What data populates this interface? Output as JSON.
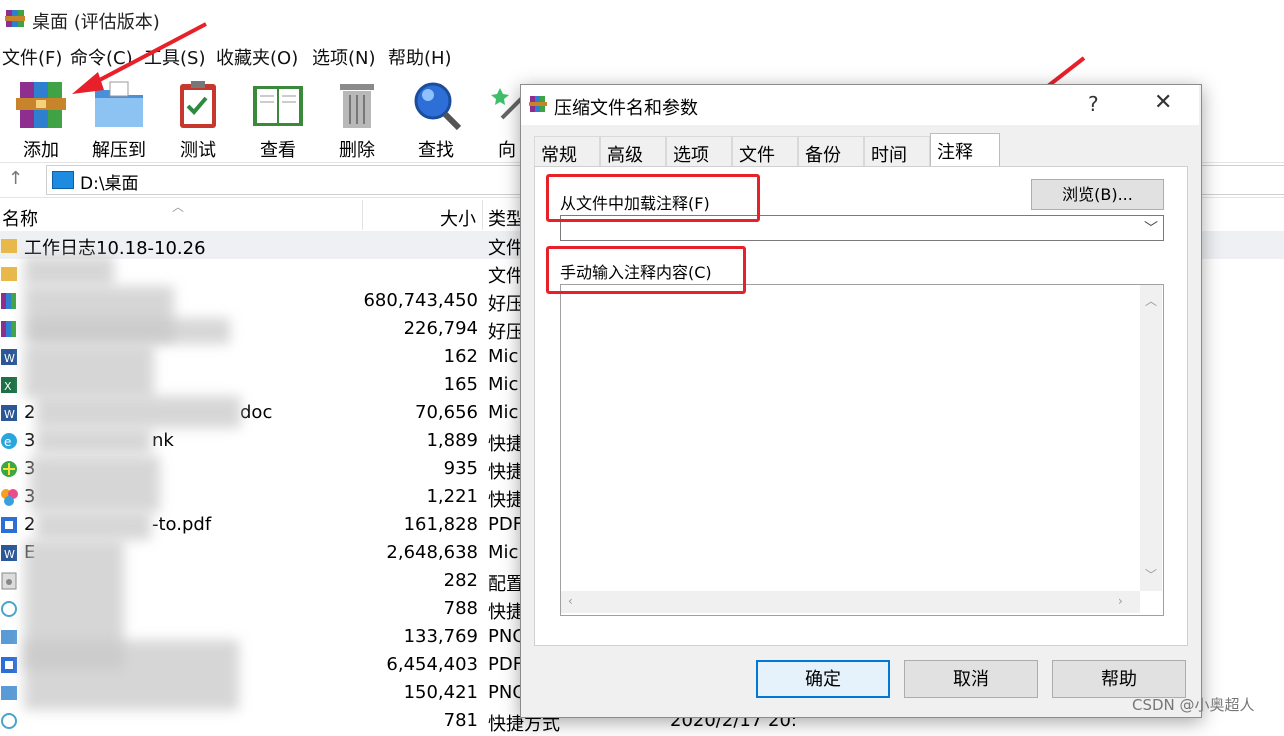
{
  "window": {
    "title": "桌面 (评估版本)"
  },
  "menu": [
    "文件(F)",
    "命令(C)",
    "工具(S)",
    "收藏夹(O)",
    "选项(N)",
    "帮助(H)"
  ],
  "toolbar": [
    "添加",
    "解压到",
    "测试",
    "查看",
    "删除",
    "查找",
    "向导"
  ],
  "address": {
    "path": "D:\\桌面"
  },
  "columns": {
    "name": "名称",
    "size": "大小",
    "type": "类型"
  },
  "files": [
    {
      "name": "工作日志10.18-10.26",
      "size": "",
      "type": "文件",
      "date": "",
      "icon": "folder-icon"
    },
    {
      "name": "",
      "size": "",
      "type": "文件",
      "date": "",
      "icon": "folder-icon"
    },
    {
      "name": "",
      "size": "680,743,450",
      "type": "好压",
      "date": "",
      "icon": "archive-icon"
    },
    {
      "name": "",
      "size": "226,794",
      "type": "好压",
      "date": "",
      "icon": "archive-icon"
    },
    {
      "name": "",
      "size": "162",
      "type": "Mic",
      "date": "",
      "icon": "word-icon"
    },
    {
      "name": "",
      "size": "165",
      "type": "Mic",
      "date": "",
      "icon": "excel-icon"
    },
    {
      "name": "2",
      "size": "70,656",
      "type": "Mic",
      "date": "",
      "icon": "word-icon"
    },
    {
      "name": "3",
      "size": "1,889",
      "type": "快捷",
      "date": "",
      "icon": "ie-shortcut-icon"
    },
    {
      "name": "3",
      "size": "935",
      "type": "快捷",
      "date": "",
      "icon": "green-shortcut-icon"
    },
    {
      "name": "3",
      "size": "1,221",
      "type": "快捷",
      "date": "",
      "icon": "app-shortcut-icon"
    },
    {
      "name": "2",
      "size": "161,828",
      "type": "PDF",
      "date": "",
      "icon": "pdf-icon"
    },
    {
      "name": "E",
      "size": "2,648,638",
      "type": "Mic",
      "date": "",
      "icon": "word-icon"
    },
    {
      "name": "",
      "size": "282",
      "type": "配置",
      "date": "",
      "icon": "config-icon"
    },
    {
      "name": "",
      "size": "788",
      "type": "快捷",
      "date": "",
      "icon": "shortcut-icon"
    },
    {
      "name": "",
      "size": "133,769",
      "type": "PNG",
      "date": "",
      "icon": "image-icon"
    },
    {
      "name": "",
      "size": "6,454,403",
      "type": "PDF",
      "date": "",
      "icon": "pdf-icon"
    },
    {
      "name": "",
      "size": "150,421",
      "type": "PNG",
      "date": "",
      "icon": "image-icon"
    },
    {
      "name": "",
      "size": "781",
      "type": "快捷方式",
      "date": "2020/2/17 20:",
      "icon": "shortcut-icon"
    }
  ],
  "partial_names": {
    "row6": "doc",
    "row7": "nk",
    "row10": "-to.pdf"
  },
  "dialog": {
    "title": "压缩文件名和参数",
    "help": "?",
    "close": "✕",
    "tabs": [
      "常规",
      "高级",
      "选项",
      "文件",
      "备份",
      "时间",
      "注释"
    ],
    "active_tab": "注释",
    "load_label": "从文件中加载注释(F)",
    "browse": "浏览(B)...",
    "combo_value": "",
    "manual_label": "手动输入注释内容(C)",
    "comment_text": "",
    "ok": "确定",
    "cancel": "取消",
    "help_btn": "帮助"
  },
  "watermark": "CSDN @小奥超人",
  "colors": {
    "annotation_red": "#e8202a",
    "focus_blue": "#0078d7"
  }
}
